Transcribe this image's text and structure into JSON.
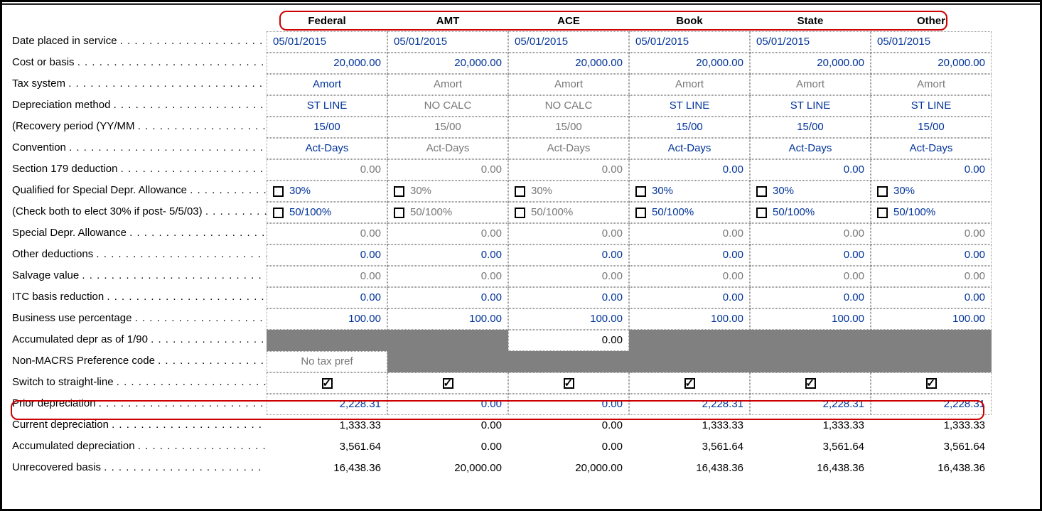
{
  "columns": [
    "Federal",
    "AMT",
    "ACE",
    "Book",
    "State",
    "Other"
  ],
  "rows": {
    "date_placed": {
      "label": "Date placed in service",
      "vals": [
        "05/01/2015",
        "05/01/2015",
        "05/01/2015",
        "05/01/2015",
        "05/01/2015",
        "05/01/2015"
      ],
      "cls": [
        "blue left",
        "blue left",
        "blue left",
        "blue left",
        "blue left",
        "blue left"
      ]
    },
    "cost": {
      "label": "Cost or basis",
      "vals": [
        "20,000.00",
        "20,000.00",
        "20,000.00",
        "20,000.00",
        "20,000.00",
        "20,000.00"
      ],
      "cls": [
        "blue",
        "blue",
        "blue",
        "blue",
        "blue",
        "blue"
      ]
    },
    "tax_system": {
      "label": "Tax system",
      "vals": [
        "Amort",
        "Amort",
        "Amort",
        "Amort",
        "Amort",
        "Amort"
      ],
      "cls": [
        "blue center",
        "gray center",
        "gray center",
        "gray center",
        "gray center",
        "gray center"
      ]
    },
    "depr_method": {
      "label": "Depreciation method",
      "vals": [
        "ST LINE",
        "NO CALC",
        "NO CALC",
        "ST LINE",
        "ST LINE",
        "ST LINE"
      ],
      "cls": [
        "blue center",
        "gray center",
        "gray center",
        "blue center",
        "blue center",
        "blue center"
      ]
    },
    "recovery": {
      "label": "(Recovery period (YY/MM",
      "vals": [
        "15/00",
        "15/00",
        "15/00",
        "15/00",
        "15/00",
        "15/00"
      ],
      "cls": [
        "blue center",
        "gray center",
        "gray center",
        "blue center",
        "blue center",
        "blue center"
      ]
    },
    "convention": {
      "label": "Convention",
      "vals": [
        "Act-Days",
        "Act-Days",
        "Act-Days",
        "Act-Days",
        "Act-Days",
        "Act-Days"
      ],
      "cls": [
        "blue center",
        "gray center",
        "gray center",
        "blue center",
        "blue center",
        "blue center"
      ]
    },
    "sec179": {
      "label": "Section 179 deduction",
      "vals": [
        "0.00",
        "0.00",
        "0.00",
        "0.00",
        "0.00",
        "0.00"
      ],
      "cls": [
        "gray",
        "gray",
        "gray",
        "blue",
        "blue",
        "blue"
      ]
    },
    "qual30": {
      "label": "Qualified for Special Depr. Allowance",
      "vals": [
        "30%",
        "30%",
        "30%",
        "30%",
        "30%",
        "30%"
      ],
      "cls": [
        "blue",
        "gray",
        "gray",
        "blue",
        "blue",
        "blue"
      ],
      "type": "check"
    },
    "qual50": {
      "label": "(Check both to elect 30% if post- 5/5/03)",
      "vals": [
        "50/100%",
        "50/100%",
        "50/100%",
        "50/100%",
        "50/100%",
        "50/100%"
      ],
      "cls": [
        "blue",
        "gray",
        "gray",
        "blue",
        "blue",
        "blue"
      ],
      "type": "check"
    },
    "spec_allow": {
      "label": "Special Depr. Allowance",
      "vals": [
        "0.00",
        "0.00",
        "0.00",
        "0.00",
        "0.00",
        "0.00"
      ],
      "cls": [
        "gray",
        "gray",
        "gray",
        "gray",
        "gray",
        "gray"
      ]
    },
    "other_ded": {
      "label": "Other deductions",
      "vals": [
        "0.00",
        "0.00",
        "0.00",
        "0.00",
        "0.00",
        "0.00"
      ],
      "cls": [
        "blue",
        "blue",
        "blue",
        "blue",
        "blue",
        "blue"
      ]
    },
    "salvage": {
      "label": "Salvage value",
      "vals": [
        "0.00",
        "0.00",
        "0.00",
        "0.00",
        "0.00",
        "0.00"
      ],
      "cls": [
        "gray",
        "gray",
        "gray",
        "gray",
        "gray",
        "gray"
      ]
    },
    "itc": {
      "label": "ITC basis reduction",
      "vals": [
        "0.00",
        "0.00",
        "0.00",
        "0.00",
        "0.00",
        "0.00"
      ],
      "cls": [
        "blue",
        "blue",
        "blue",
        "blue",
        "blue",
        "blue"
      ]
    },
    "buspct": {
      "label": "Business use percentage",
      "vals": [
        "100.00",
        "100.00",
        "100.00",
        "100.00",
        "100.00",
        "100.00"
      ],
      "cls": [
        "blue",
        "blue",
        "blue",
        "blue",
        "blue",
        "blue"
      ]
    },
    "accum90": {
      "label": "Accumulated depr as of 1/90",
      "vals": [
        "",
        "",
        "0.00",
        "",
        "",
        ""
      ],
      "type": "dark",
      "darkmask": [
        true,
        true,
        false,
        true,
        true,
        true
      ]
    },
    "nonmacrs": {
      "label": "Non-MACRS Preference code",
      "vals": [
        "No tax pref",
        "",
        "",
        "",
        "",
        ""
      ],
      "type": "dark",
      "darkmask": [
        false,
        true,
        true,
        true,
        true,
        true
      ],
      "cls": [
        "gray center",
        "",
        "",
        "",
        "",
        ""
      ]
    },
    "switch": {
      "label": "Switch to straight-line",
      "vals": [
        "",
        "",
        "",
        "",
        "",
        ""
      ],
      "type": "checked"
    },
    "prior": {
      "label": "Prior depreciation",
      "vals": [
        "2,228.31",
        "0.00",
        "0.00",
        "2,228.31",
        "2,228.31",
        "2,228.31"
      ],
      "cls": [
        "blue",
        "blue",
        "blue",
        "blue",
        "blue",
        "blue"
      ]
    },
    "current": {
      "label": "Current depreciation",
      "vals": [
        "1,333.33",
        "0.00",
        "0.00",
        "1,333.33",
        "1,333.33",
        "1,333.33"
      ],
      "cls": [
        "nobord",
        "nobord",
        "nobord",
        "nobord",
        "nobord",
        "nobord"
      ]
    },
    "accum": {
      "label": "Accumulated depreciation",
      "vals": [
        "3,561.64",
        "0.00",
        "0.00",
        "3,561.64",
        "3,561.64",
        "3,561.64"
      ],
      "cls": [
        "nobord",
        "nobord",
        "nobord",
        "nobord",
        "nobord",
        "nobord"
      ]
    },
    "unrec": {
      "label": "Unrecovered basis",
      "vals": [
        "16,438.36",
        "20,000.00",
        "20,000.00",
        "16,438.36",
        "16,438.36",
        "16,438.36"
      ],
      "cls": [
        "nobord",
        "nobord",
        "nobord",
        "nobord",
        "nobord",
        "nobord"
      ]
    }
  },
  "row_order": [
    "date_placed",
    "cost",
    "tax_system",
    "depr_method",
    "recovery",
    "convention",
    "sec179",
    "qual30",
    "qual50",
    "spec_allow",
    "other_ded",
    "salvage",
    "itc",
    "buspct",
    "accum90",
    "nonmacrs",
    "switch",
    "prior",
    "current",
    "accum",
    "unrec"
  ]
}
